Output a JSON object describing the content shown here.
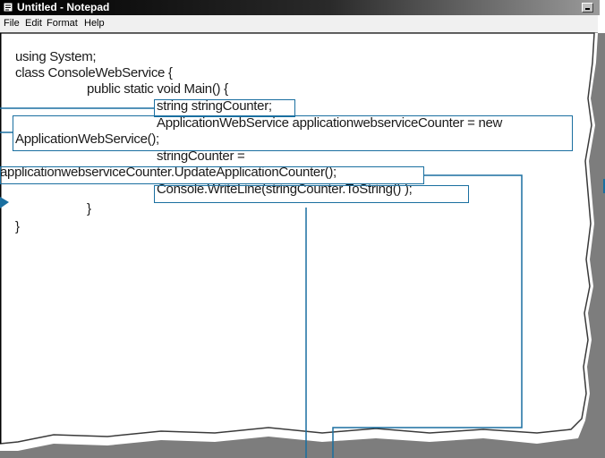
{
  "window": {
    "title": "Untitled - Notepad"
  },
  "menu": [
    "File",
    "Edit",
    "Format",
    "Help"
  ],
  "code": [
    "using System;",
    "class ConsoleWebService {",
    "public static void Main() {",
    "string stringCounter;",
    "ApplicationWebService applicationwebserviceCounter = new",
    "ApplicationWebService();",
    "stringCounter =",
    "applicationwebserviceCounter.UpdateApplicationCounter();",
    "Console.WriteLine(stringCounter.ToString() );",
    "}",
    "}"
  ],
  "colors": {
    "callout": "#1a6fa0",
    "titlebar": "#000000"
  }
}
